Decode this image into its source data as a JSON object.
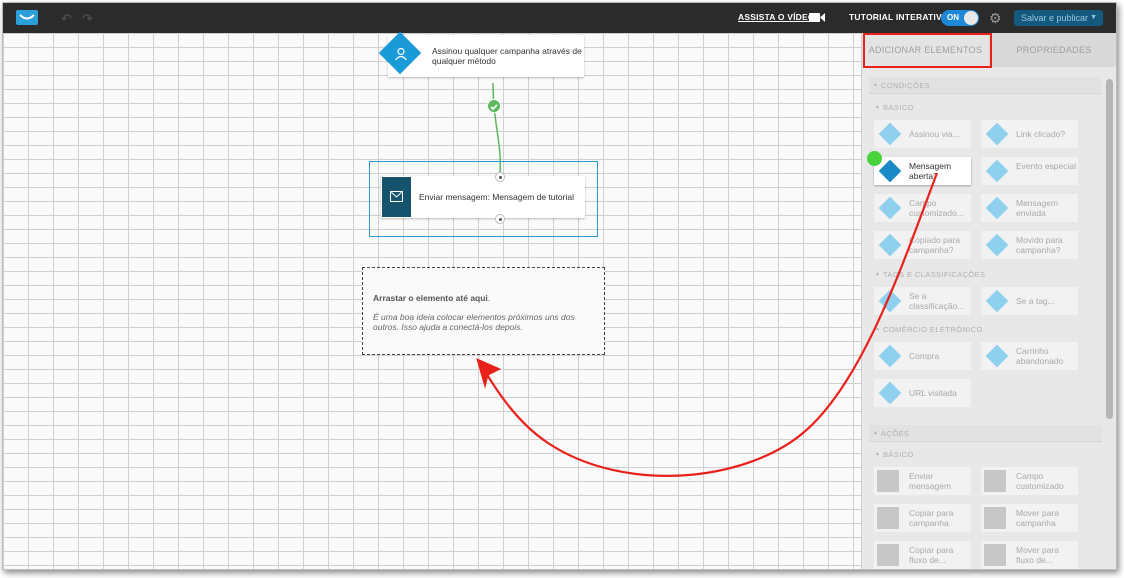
{
  "topbar": {
    "watch_video": "ASSISTA O VÍDEO",
    "tutorial_label": "TUTORIAL INTERATIVO",
    "toggle_state": "ON",
    "save_publish": "Salvar e publicar",
    "accent_color": "#1e88d8"
  },
  "canvas": {
    "trigger_node": "Assinou qualquer campanha através de qualquer método",
    "action_node": "Enviar mensagem: Mensagem de tutorial",
    "dropzone": {
      "title": "Arrastar o elemento até aqui",
      "title_suffix": ".",
      "tip": "É uma boa ideia colocar elementos próximos uns dos outros. Isso ajuda a conectá-los depois."
    }
  },
  "panel": {
    "tabs": [
      "ADICIONAR ELEMENTOS",
      "PROPRIEDADES"
    ],
    "sections": {
      "conditions": "CONDIÇÕES",
      "basic": "BÁSICO",
      "tags": "TAGS E CLASSIFICAÇÕES",
      "ecommerce": "COMÉRCIO ELETRÔNICO",
      "actions": "AÇÕES",
      "actions_basic": "BÁSICO"
    },
    "conditions_basic": [
      "Assinou via...",
      "Link clicado?",
      "Mensagem aberta?",
      "Evento especial",
      "Campo customizado...",
      "Mensagem enviada",
      "Copiado para campanha?",
      "Movido para campanha?"
    ],
    "tags_items": [
      "Se a classificação...",
      "Se a tag..."
    ],
    "ecommerce_items": [
      "Compra",
      "Carrinho abandonado",
      "URL visitada"
    ],
    "actions_basic": [
      "Enviar mensagem",
      "Campo customizado",
      "Copiar para campanha",
      "Mover para campanha",
      "Copiar para fluxo de...",
      "Mover para fluxo de..."
    ]
  }
}
